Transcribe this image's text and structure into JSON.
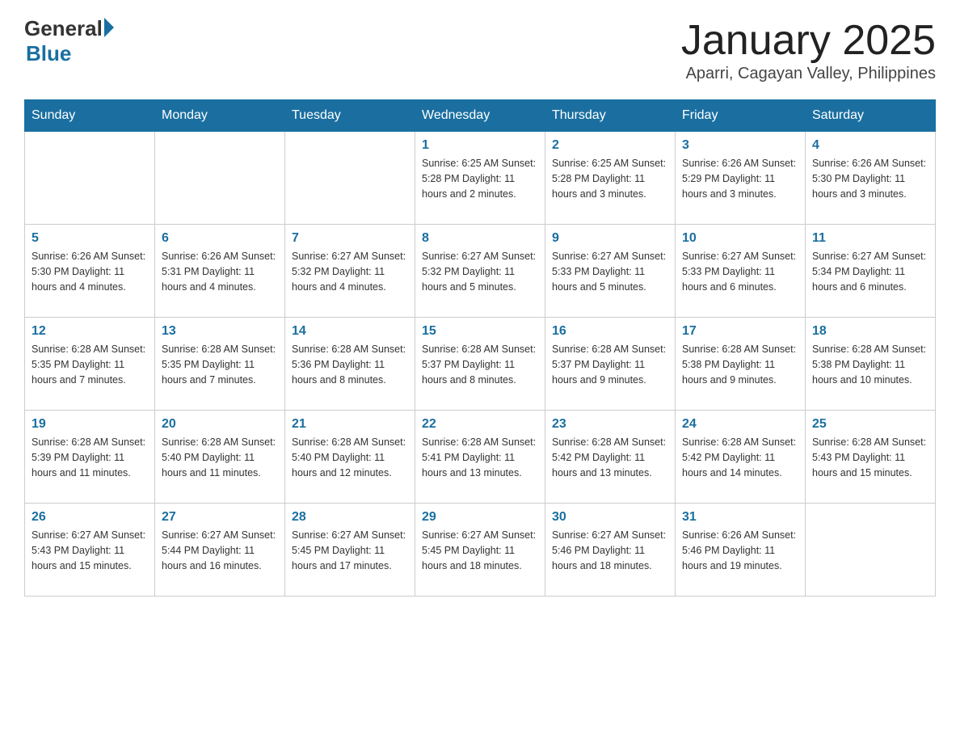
{
  "header": {
    "logo": {
      "text_general": "General",
      "text_blue": "Blue"
    },
    "title": "January 2025",
    "subtitle": "Aparri, Cagayan Valley, Philippines"
  },
  "calendar": {
    "days_of_week": [
      "Sunday",
      "Monday",
      "Tuesday",
      "Wednesday",
      "Thursday",
      "Friday",
      "Saturday"
    ],
    "weeks": [
      [
        {
          "day": "",
          "info": ""
        },
        {
          "day": "",
          "info": ""
        },
        {
          "day": "",
          "info": ""
        },
        {
          "day": "1",
          "info": "Sunrise: 6:25 AM\nSunset: 5:28 PM\nDaylight: 11 hours and 2 minutes."
        },
        {
          "day": "2",
          "info": "Sunrise: 6:25 AM\nSunset: 5:28 PM\nDaylight: 11 hours and 3 minutes."
        },
        {
          "day": "3",
          "info": "Sunrise: 6:26 AM\nSunset: 5:29 PM\nDaylight: 11 hours and 3 minutes."
        },
        {
          "day": "4",
          "info": "Sunrise: 6:26 AM\nSunset: 5:30 PM\nDaylight: 11 hours and 3 minutes."
        }
      ],
      [
        {
          "day": "5",
          "info": "Sunrise: 6:26 AM\nSunset: 5:30 PM\nDaylight: 11 hours and 4 minutes."
        },
        {
          "day": "6",
          "info": "Sunrise: 6:26 AM\nSunset: 5:31 PM\nDaylight: 11 hours and 4 minutes."
        },
        {
          "day": "7",
          "info": "Sunrise: 6:27 AM\nSunset: 5:32 PM\nDaylight: 11 hours and 4 minutes."
        },
        {
          "day": "8",
          "info": "Sunrise: 6:27 AM\nSunset: 5:32 PM\nDaylight: 11 hours and 5 minutes."
        },
        {
          "day": "9",
          "info": "Sunrise: 6:27 AM\nSunset: 5:33 PM\nDaylight: 11 hours and 5 minutes."
        },
        {
          "day": "10",
          "info": "Sunrise: 6:27 AM\nSunset: 5:33 PM\nDaylight: 11 hours and 6 minutes."
        },
        {
          "day": "11",
          "info": "Sunrise: 6:27 AM\nSunset: 5:34 PM\nDaylight: 11 hours and 6 minutes."
        }
      ],
      [
        {
          "day": "12",
          "info": "Sunrise: 6:28 AM\nSunset: 5:35 PM\nDaylight: 11 hours and 7 minutes."
        },
        {
          "day": "13",
          "info": "Sunrise: 6:28 AM\nSunset: 5:35 PM\nDaylight: 11 hours and 7 minutes."
        },
        {
          "day": "14",
          "info": "Sunrise: 6:28 AM\nSunset: 5:36 PM\nDaylight: 11 hours and 8 minutes."
        },
        {
          "day": "15",
          "info": "Sunrise: 6:28 AM\nSunset: 5:37 PM\nDaylight: 11 hours and 8 minutes."
        },
        {
          "day": "16",
          "info": "Sunrise: 6:28 AM\nSunset: 5:37 PM\nDaylight: 11 hours and 9 minutes."
        },
        {
          "day": "17",
          "info": "Sunrise: 6:28 AM\nSunset: 5:38 PM\nDaylight: 11 hours and 9 minutes."
        },
        {
          "day": "18",
          "info": "Sunrise: 6:28 AM\nSunset: 5:38 PM\nDaylight: 11 hours and 10 minutes."
        }
      ],
      [
        {
          "day": "19",
          "info": "Sunrise: 6:28 AM\nSunset: 5:39 PM\nDaylight: 11 hours and 11 minutes."
        },
        {
          "day": "20",
          "info": "Sunrise: 6:28 AM\nSunset: 5:40 PM\nDaylight: 11 hours and 11 minutes."
        },
        {
          "day": "21",
          "info": "Sunrise: 6:28 AM\nSunset: 5:40 PM\nDaylight: 11 hours and 12 minutes."
        },
        {
          "day": "22",
          "info": "Sunrise: 6:28 AM\nSunset: 5:41 PM\nDaylight: 11 hours and 13 minutes."
        },
        {
          "day": "23",
          "info": "Sunrise: 6:28 AM\nSunset: 5:42 PM\nDaylight: 11 hours and 13 minutes."
        },
        {
          "day": "24",
          "info": "Sunrise: 6:28 AM\nSunset: 5:42 PM\nDaylight: 11 hours and 14 minutes."
        },
        {
          "day": "25",
          "info": "Sunrise: 6:28 AM\nSunset: 5:43 PM\nDaylight: 11 hours and 15 minutes."
        }
      ],
      [
        {
          "day": "26",
          "info": "Sunrise: 6:27 AM\nSunset: 5:43 PM\nDaylight: 11 hours and 15 minutes."
        },
        {
          "day": "27",
          "info": "Sunrise: 6:27 AM\nSunset: 5:44 PM\nDaylight: 11 hours and 16 minutes."
        },
        {
          "day": "28",
          "info": "Sunrise: 6:27 AM\nSunset: 5:45 PM\nDaylight: 11 hours and 17 minutes."
        },
        {
          "day": "29",
          "info": "Sunrise: 6:27 AM\nSunset: 5:45 PM\nDaylight: 11 hours and 18 minutes."
        },
        {
          "day": "30",
          "info": "Sunrise: 6:27 AM\nSunset: 5:46 PM\nDaylight: 11 hours and 18 minutes."
        },
        {
          "day": "31",
          "info": "Sunrise: 6:26 AM\nSunset: 5:46 PM\nDaylight: 11 hours and 19 minutes."
        },
        {
          "day": "",
          "info": ""
        }
      ]
    ]
  }
}
